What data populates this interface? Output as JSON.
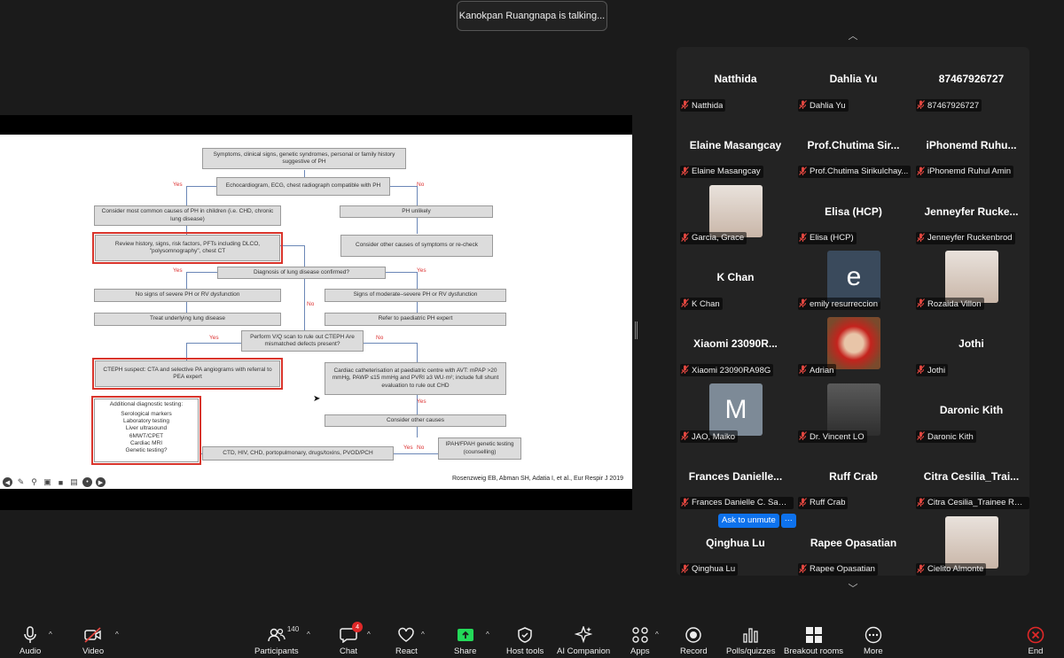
{
  "talking_banner": "Kanokpan Ruangnapa is talking...",
  "slide": {
    "boxes": {
      "symptoms": "Symptoms, clinical signs, genetic syndromes, personal or family history suggestive of PH",
      "echo": "Echocardiogram, ECG, chest radiograph compatible with PH",
      "common_causes": "Consider most common causes of PH in children (i.e. CHD, chronic lung disease)",
      "ph_unlikely": "PH unlikely",
      "review_history": "Review history, signs, risk factors, PFTs including DLCO, \"polysomnography\", chest CT",
      "other_causes": "Consider other causes of symptoms or re-check",
      "lung_confirmed": "Diagnosis of lung disease confirmed?",
      "no_severe": "No signs of severe PH or RV dysfunction",
      "moderate_severe": "Signs of moderate–severe PH or RV dysfunction",
      "treat_lung": "Treat underlying lung disease",
      "refer_expert": "Refer to paediatric PH expert",
      "vq_scan": "Perform V/Q scan to rule out CTEPH Are mismatched defects present?",
      "cteph": "CTEPH suspect: CTA and selective PA angiograms with referral to PEA expert",
      "cath": "Cardiac catheterisation at paediatric centre with AVT: mPAP >20 mmHg, PAWP ≤15 mmHg and PVRI ≥3 WU·m²; include full shunt evaluation to rule out CHD",
      "consider_other": "Consider other causes",
      "additional_title": "Additional diagnostic testing:",
      "additional_items": "Serological markers\nLaboratory testing\nLiver ultrasound\n6MWT/CPET\nCardiac MRI\nGenetic testing?",
      "ctd": "CTD, HIV, CHD, portopulmonary, drugs/toxins, PVOD/PCH",
      "ipah": "IPAH/FPAH genetic testing (counselling)"
    },
    "labels": {
      "yes": "Yes",
      "no": "No"
    },
    "citation": "Rosenzweig EB, Abman SH, Adatia I, et al., Eur Respir J 2019"
  },
  "participants": [
    {
      "big": "Natthida",
      "tag": "Natthida",
      "avatar": null
    },
    {
      "big": "Dahlia Yu",
      "tag": "Dahlia Yu",
      "avatar": null
    },
    {
      "big": "87467926727",
      "tag": "87467926727",
      "avatar": null
    },
    {
      "big": "Elaine Masangcay",
      "tag": "Elaine Masangcay",
      "avatar": null
    },
    {
      "big": "Prof.Chutima  Sir...",
      "tag": "Prof.Chutima Sirikulchay...",
      "avatar": null
    },
    {
      "big": "iPhonemd  Ruhu...",
      "tag": "iPhonemd Ruhul Amin",
      "avatar": null
    },
    {
      "big": "",
      "tag": "Garcia, Grace",
      "avatar": "photo-woman"
    },
    {
      "big": "Elisa (HCP)",
      "tag": "Elisa (HCP)",
      "avatar": null
    },
    {
      "big": "Jenneyfer  Rucke...",
      "tag": "Jenneyfer Ruckenbrod",
      "avatar": null
    },
    {
      "big": "K Chan",
      "tag": "K Chan",
      "avatar": null
    },
    {
      "big": "",
      "tag": "emily resurreccion",
      "avatar": "letter-e"
    },
    {
      "big": "",
      "tag": "Rozaida Villon",
      "avatar": "photo-woman"
    },
    {
      "big": "Xiaomi  23090R...",
      "tag": "Xiaomi 23090RA98G",
      "avatar": null
    },
    {
      "big": "",
      "tag": "Adrian",
      "avatar": "photo-daruma"
    },
    {
      "big": "Jothi",
      "tag": "Jothi",
      "avatar": null
    },
    {
      "big": "",
      "tag": "JAO, Maiko",
      "avatar": "letter-m"
    },
    {
      "big": "",
      "tag": "Dr. Vincent LO",
      "avatar": "photo-man"
    },
    {
      "big": "Daronic Kith",
      "tag": "Daronic Kith",
      "avatar": null
    },
    {
      "big": "Frances  Danielle...",
      "tag": "Frances Danielle C. Sabu...",
      "avatar": null
    },
    {
      "big": "Ruff Crab",
      "tag": "Ruff Crab",
      "avatar": null
    },
    {
      "big": "Citra  Cesilia_Trai...",
      "tag": "Citra Cesilia_Trainee Res...",
      "avatar": null
    },
    {
      "big": "Qinghua Lu",
      "tag": "Qinghua Lu",
      "avatar": null
    },
    {
      "big": "Rapee Opasatian",
      "tag": "Rapee Opasatian",
      "avatar": null
    },
    {
      "big": "",
      "tag": "Cielito Almonte",
      "avatar": "photo-woman"
    }
  ],
  "avatar_letters": {
    "letter-e": "e",
    "letter-m": "M"
  },
  "ask_to_unmute": "Ask to unmute",
  "ask_more": "···",
  "toolbar": {
    "audio": "Audio",
    "video": "Video",
    "participants": "Participants",
    "participants_count": "140",
    "chat": "Chat",
    "chat_badge": "4",
    "react": "React",
    "share": "Share",
    "host_tools": "Host tools",
    "ai_companion": "AI Companion",
    "apps": "Apps",
    "record": "Record",
    "polls": "Polls/quizzes",
    "breakout": "Breakout rooms",
    "more": "More",
    "end": "End"
  },
  "colors": {
    "accent_blue": "#0e72ed",
    "share_green": "#23d959",
    "muted_red": "#e0463f",
    "highlight_red": "#d9342b"
  }
}
